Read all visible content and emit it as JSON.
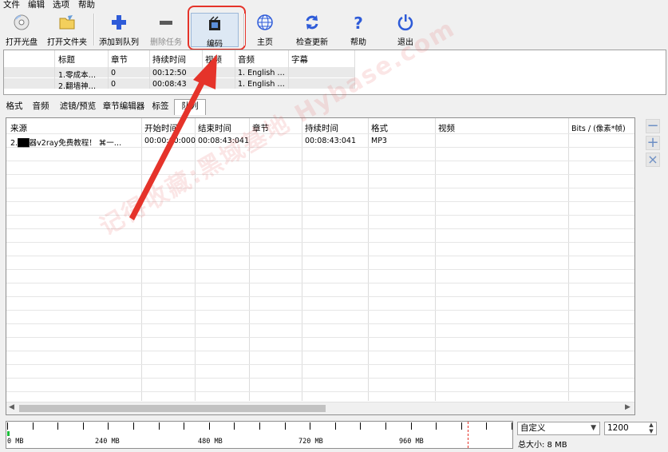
{
  "menu": [
    "文件",
    "编辑",
    "选项",
    "帮助"
  ],
  "toolbar": {
    "open_disc": "打开光盘",
    "open_folder": "打开文件夹",
    "add_queue": "添加到队列",
    "remove_task": "删除任务",
    "encode": "编码",
    "home": "主页",
    "check_update": "检查更新",
    "help": "帮助",
    "exit": "退出"
  },
  "title_table": {
    "columns": [
      "标题",
      "章节",
      "持续时间",
      "视频",
      "音频",
      "字幕"
    ],
    "rows": [
      [
        "1.零成本…",
        "0",
        "00:12:50",
        "",
        "1. English …",
        ""
      ],
      [
        "2.翻墙神…",
        "0",
        "00:08:43",
        "",
        "1. English …",
        ""
      ]
    ]
  },
  "tabs": [
    "格式",
    "音频",
    "滤镜/预览",
    "章节编辑器",
    "标签",
    "队列"
  ],
  "queue": {
    "columns": [
      "来源",
      "开始时间",
      "结束时间",
      "章节",
      "持续时间",
      "格式",
      "视频",
      "Bits / (像素*帧)"
    ],
    "rows": [
      [
        "2.██器v2ray免费教程！ ⌘一…",
        "00:00:00:000",
        "00:08:43:041",
        "",
        "00:08:43:041",
        "MP3",
        "",
        ""
      ]
    ]
  },
  "side_buttons": [
    "−",
    "+",
    "×"
  ],
  "ruler": {
    "labels": [
      "0 MB",
      "240 MB",
      "480 MB",
      "720 MB",
      "960 MB"
    ],
    "used_mb": 8
  },
  "size_mode": "自定义",
  "size_value": "1200",
  "total_size": "总大小: 8 MB",
  "watermark": "记得收藏:黑域基地 Hybase.com",
  "colors": {
    "highlight": "#e5332a",
    "accent": "#2e5bd8"
  }
}
